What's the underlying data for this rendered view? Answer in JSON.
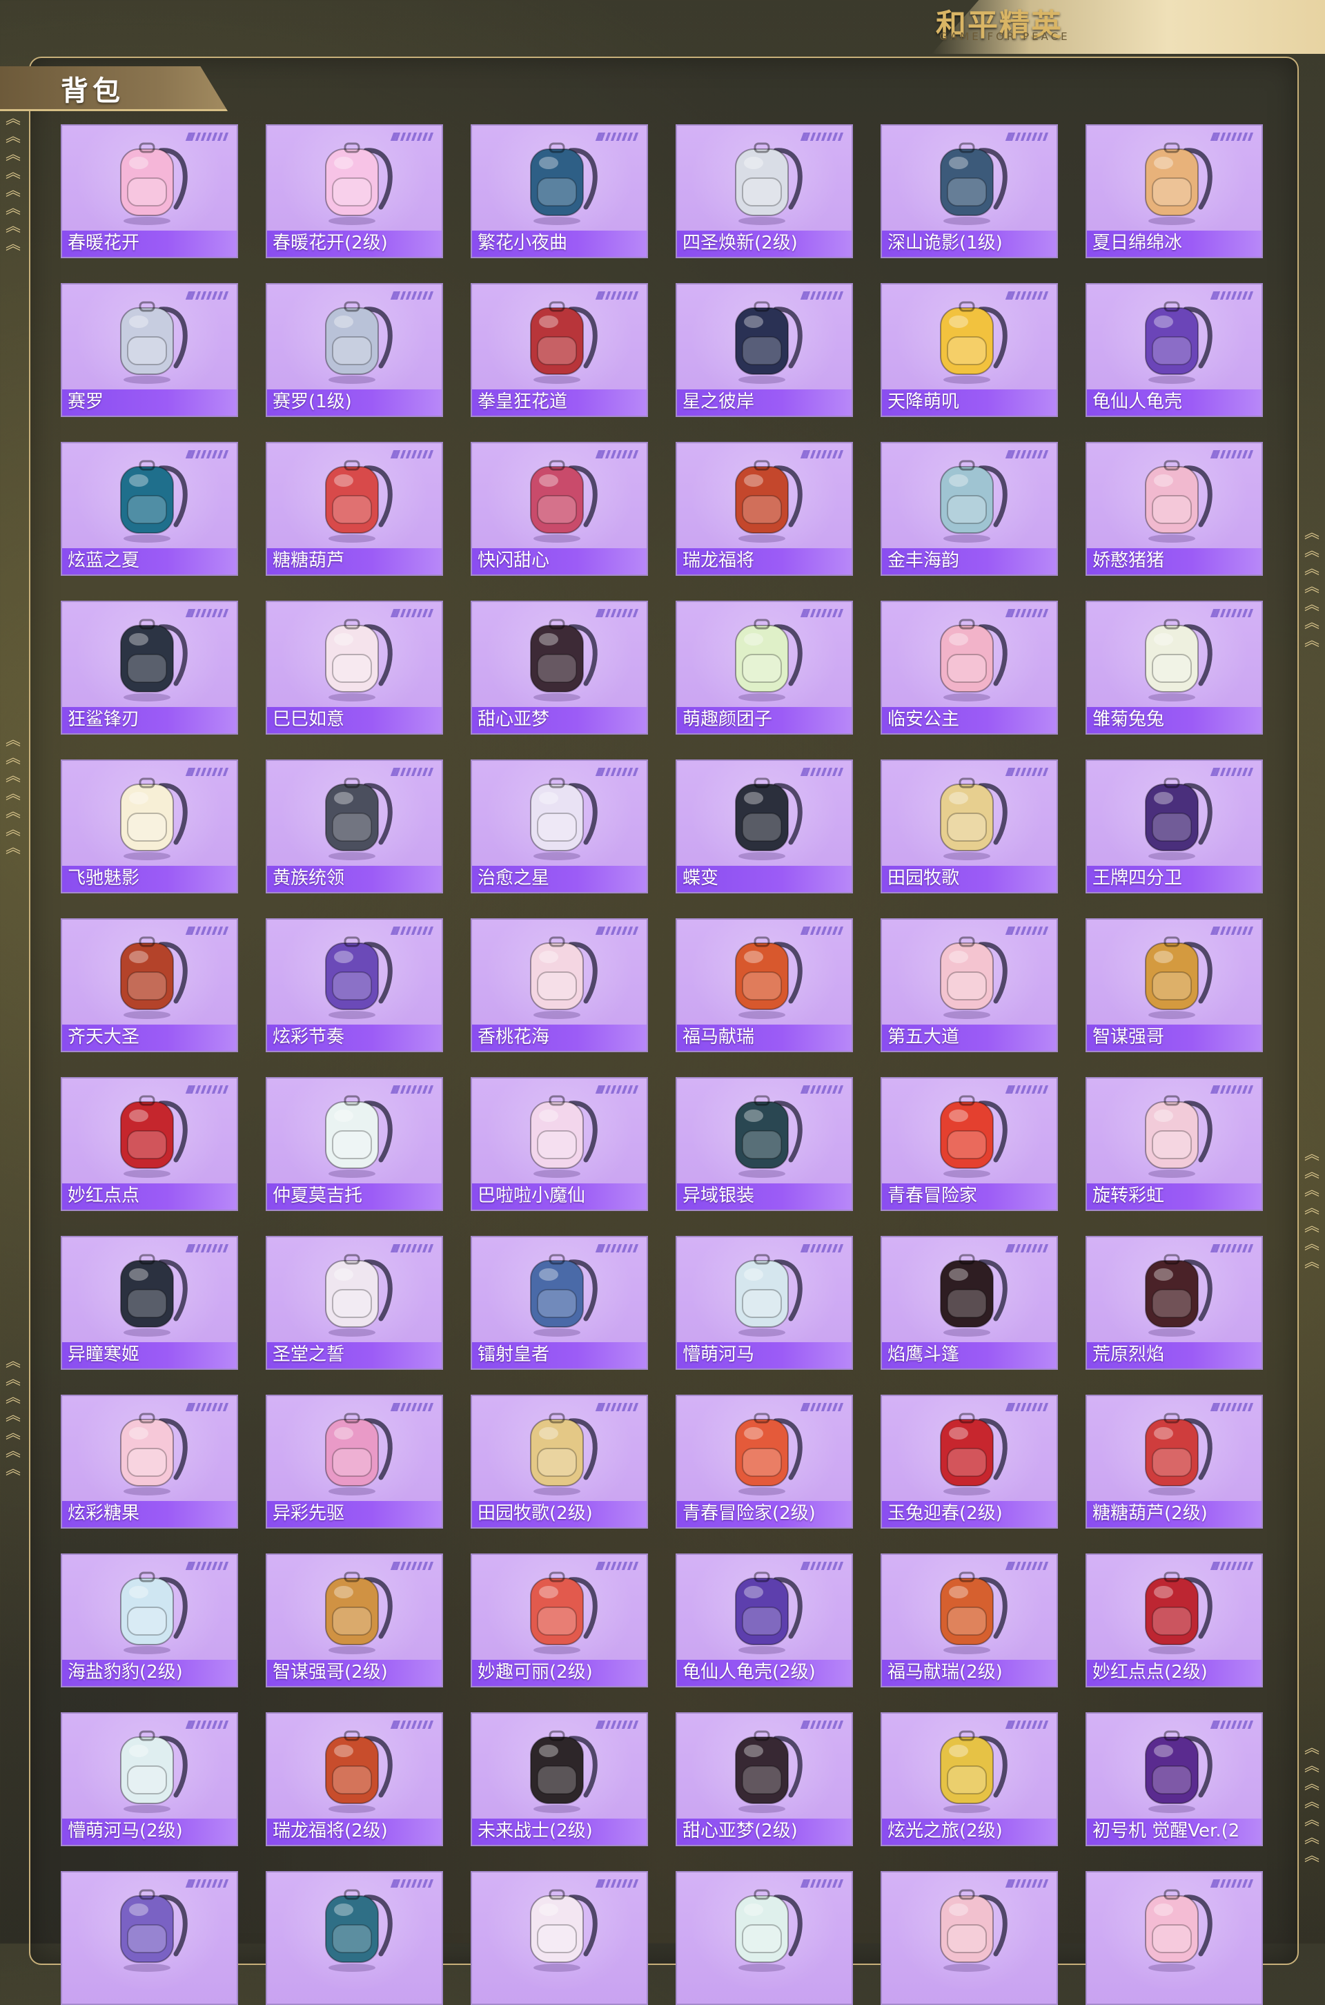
{
  "header": {
    "logo_title": "和平精英",
    "logo_subtitle": "GAME FOR PEACE",
    "section_title": "背包"
  },
  "items": [
    {
      "name": "春暖花开",
      "color": "#f5b6d8"
    },
    {
      "name": "春暖花开(2级)",
      "color": "#f7c3e6"
    },
    {
      "name": "繁花小夜曲",
      "color": "#2e5f86"
    },
    {
      "name": "四圣焕新(2级)",
      "color": "#d9dde6"
    },
    {
      "name": "深山诡影(1级)",
      "color": "#3c5a7a"
    },
    {
      "name": "夏日绵绵冰",
      "color": "#e8b27a"
    },
    {
      "name": "赛罗",
      "color": "#c7cde0"
    },
    {
      "name": "赛罗(1级)",
      "color": "#b9c2d8"
    },
    {
      "name": "拳皇狂花道",
      "color": "#b8353a"
    },
    {
      "name": "星之彼岸",
      "color": "#2a3154"
    },
    {
      "name": "天降萌叽",
      "color": "#f2c23e"
    },
    {
      "name": "龟仙人龟壳",
      "color": "#6b45b8"
    },
    {
      "name": "炫蓝之夏",
      "color": "#1f6f8c"
    },
    {
      "name": "糖糖葫芦",
      "color": "#d84a4a"
    },
    {
      "name": "快闪甜心",
      "color": "#c94b6b"
    },
    {
      "name": "瑞龙福将",
      "color": "#c4472c"
    },
    {
      "name": "金丰海韵",
      "color": "#9fc4d2"
    },
    {
      "name": "娇憨猪猪",
      "color": "#f1b9cf"
    },
    {
      "name": "狂鲨锋刃",
      "color": "#2c3444"
    },
    {
      "name": "巳巳如意",
      "color": "#f5e3ec"
    },
    {
      "name": "甜心亚梦",
      "color": "#3d2a36"
    },
    {
      "name": "萌趣颜团子",
      "color": "#dff0c8"
    },
    {
      "name": "临安公主",
      "color": "#f2b3c9"
    },
    {
      "name": "雏菊兔兔",
      "color": "#eef0df"
    },
    {
      "name": "飞驰魅影",
      "color": "#f7efd6"
    },
    {
      "name": "黄族统领",
      "color": "#4b4f5e"
    },
    {
      "name": "治愈之星",
      "color": "#e9e2f4"
    },
    {
      "name": "蝶变",
      "color": "#2b2f3c"
    },
    {
      "name": "田园牧歌",
      "color": "#e7cf8f"
    },
    {
      "name": "王牌四分卫",
      "color": "#4a2f7c"
    },
    {
      "name": "齐天大圣",
      "color": "#b4432a"
    },
    {
      "name": "炫彩节奏",
      "color": "#6b4ab8"
    },
    {
      "name": "香桃花海",
      "color": "#f4d6e2"
    },
    {
      "name": "福马献瑞",
      "color": "#d8582d"
    },
    {
      "name": "第五大道",
      "color": "#f4c4d0"
    },
    {
      "name": "智谋强哥",
      "color": "#d49a3f"
    },
    {
      "name": "妙红点点",
      "color": "#c5262d"
    },
    {
      "name": "仲夏莫吉托",
      "color": "#eaf3f2"
    },
    {
      "name": "巴啦啦小魔仙",
      "color": "#f3d6ec"
    },
    {
      "name": "异域银装",
      "color": "#2a4752"
    },
    {
      "name": "青春冒险家",
      "color": "#e4402f"
    },
    {
      "name": "旋转彩虹",
      "color": "#f2cbd9"
    },
    {
      "name": "异瞳寒姬",
      "color": "#2b3140"
    },
    {
      "name": "圣堂之誓",
      "color": "#efe6f0"
    },
    {
      "name": "镭射皇者",
      "color": "#4a6aa8"
    },
    {
      "name": "懵萌河马",
      "color": "#d5e6ee"
    },
    {
      "name": "焰鹰斗篷",
      "color": "#2e1d22"
    },
    {
      "name": "荒原烈焰",
      "color": "#4a2228"
    },
    {
      "name": "炫彩糖果",
      "color": "#f6c8d8"
    },
    {
      "name": "异彩先驱",
      "color": "#e99ac7"
    },
    {
      "name": "田园牧歌(2级)",
      "color": "#e4c886"
    },
    {
      "name": "青春冒险家(2级)",
      "color": "#e45a3a"
    },
    {
      "name": "玉兔迎春(2级)",
      "color": "#c7262e"
    },
    {
      "name": "糖糖葫芦(2级)",
      "color": "#cf3d3d"
    },
    {
      "name": "海盐豹豹(2级)",
      "color": "#cfe6f2"
    },
    {
      "name": "智谋强哥(2级)",
      "color": "#d09243"
    },
    {
      "name": "妙趣可丽(2级)",
      "color": "#e25a4d"
    },
    {
      "name": "龟仙人龟壳(2级)",
      "color": "#5d3fad"
    },
    {
      "name": "福马献瑞(2级)",
      "color": "#d6602f"
    },
    {
      "name": "妙红点点(2级)",
      "color": "#bd2632"
    },
    {
      "name": "懵萌河马(2级)",
      "color": "#dfeef0"
    },
    {
      "name": "瑞龙福将(2级)",
      "color": "#c84d2c"
    },
    {
      "name": "未来战士(2级)",
      "color": "#2d2629"
    },
    {
      "name": "甜心亚梦(2级)",
      "color": "#372833"
    },
    {
      "name": "炫光之旅(2级)",
      "color": "#e6c245"
    },
    {
      "name": "初号机 觉醒Ver.(2",
      "color": "#5a2b8f"
    },
    {
      "name": "",
      "color": "#7a62c4"
    },
    {
      "name": "",
      "color": "#2f6f86"
    },
    {
      "name": "",
      "color": "#f3e6f2"
    },
    {
      "name": "",
      "color": "#dff0ec"
    },
    {
      "name": "",
      "color": "#f2c1cf"
    },
    {
      "name": "",
      "color": "#f4bcd4"
    }
  ]
}
